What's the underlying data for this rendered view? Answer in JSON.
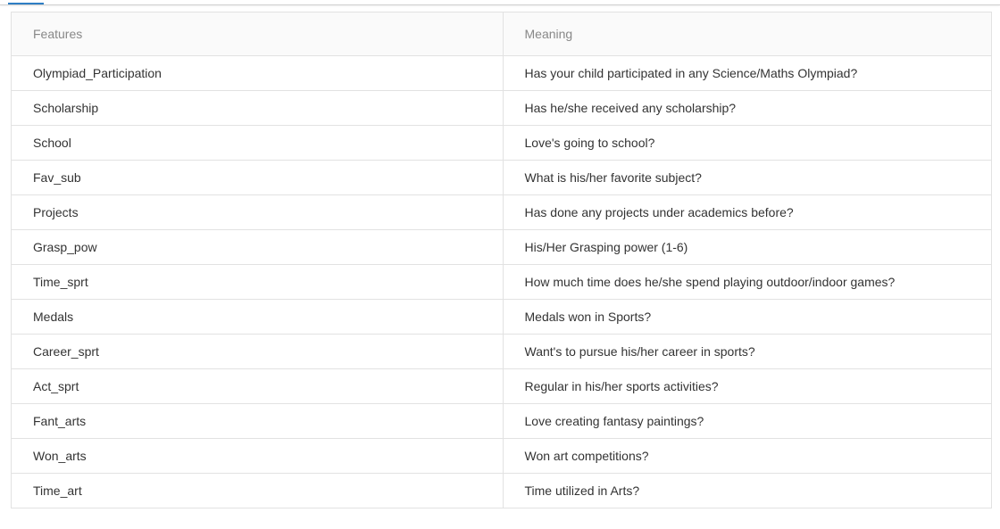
{
  "table": {
    "headers": [
      "Features",
      "Meaning"
    ],
    "rows": [
      [
        "Olympiad_Participation",
        "Has your child participated in any Science/Maths Olympiad?"
      ],
      [
        "Scholarship",
        "Has he/she received any scholarship?"
      ],
      [
        "School",
        "Love's going to school?"
      ],
      [
        "Fav_sub",
        "What is his/her favorite subject?"
      ],
      [
        "Projects",
        "Has done any projects under academics before?"
      ],
      [
        "Grasp_pow",
        "His/Her Grasping power (1-6)"
      ],
      [
        "Time_sprt",
        "How much time does he/she spend playing outdoor/indoor games?"
      ],
      [
        "Medals",
        "Medals won in Sports?"
      ],
      [
        "Career_sprt",
        "Want's to pursue his/her career in sports?"
      ],
      [
        "Act_sprt",
        "Regular in his/her sports activities?"
      ],
      [
        "Fant_arts",
        "Love creating fantasy paintings?"
      ],
      [
        "Won_arts",
        "Won art competitions?"
      ],
      [
        "Time_art",
        "Time utilized in Arts?"
      ]
    ]
  },
  "colors": {
    "accent": "#2f7ec4",
    "header_text": "#888888",
    "cell_text": "#333333",
    "border": "#e2e2e2"
  }
}
